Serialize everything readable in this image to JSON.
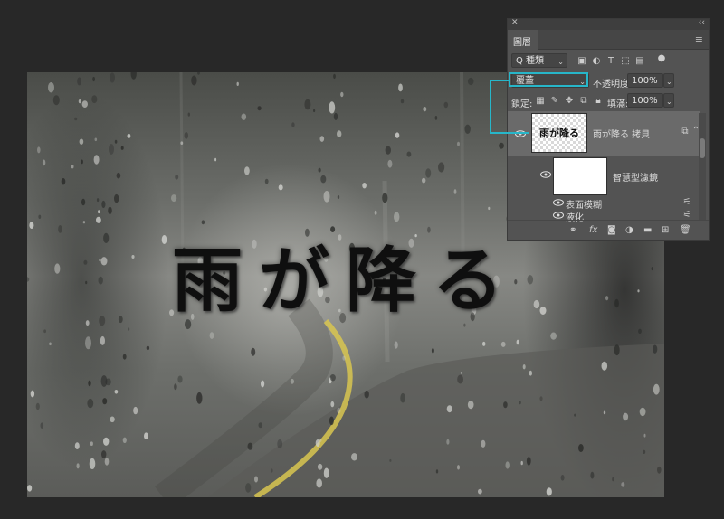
{
  "canvas": {
    "title_text": "雨が降る"
  },
  "layers_panel": {
    "tab_label": "圖層",
    "filter": {
      "label": "Q 種類"
    },
    "blend_mode": "覆蓋",
    "opacity_label": "不透明度:",
    "opacity_value": "100%",
    "lock_label": "鎖定:",
    "fill_label": "填滿:",
    "fill_value": "100%",
    "layers": [
      {
        "name": "雨が降る 拷貝",
        "thumb_text": "雨が降る"
      },
      {
        "name": "智慧型濾鏡"
      },
      {
        "name": "表面模糊"
      },
      {
        "name": "液化"
      }
    ]
  },
  "colors": {
    "callout": "#27b6c9",
    "panel_bg": "#535353",
    "app_bg": "#282828",
    "road_line": "#d8c650"
  }
}
